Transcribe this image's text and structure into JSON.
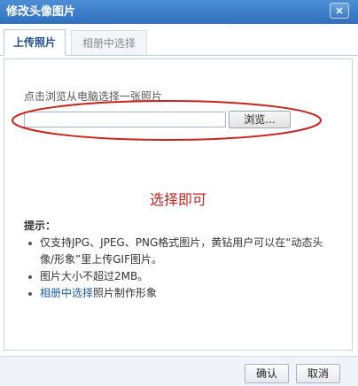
{
  "window": {
    "title": "修改头像图片",
    "close_label": "×"
  },
  "tabs": [
    {
      "label": "上传照片",
      "active": true
    },
    {
      "label": "相册中选择",
      "active": false
    }
  ],
  "upload": {
    "hint": "点击浏览从电脑选择一张照片",
    "file_value": "",
    "browse_label": "浏览..."
  },
  "annotation": {
    "text": "选择即可",
    "color": "#c8241f"
  },
  "tips": {
    "title": "提示：",
    "items": [
      "仅支持JPG、JPEG、PNG格式图片，黄钻用户可以在“动态头像/形象”里上传GIF图片。",
      "图片大小不超过2MB。"
    ],
    "link_item": {
      "link": "相册中选择",
      "rest": "照片制作形象"
    }
  },
  "footer": {
    "ok_label": "确认",
    "cancel_label": "取消"
  },
  "colors": {
    "accent": "#2f6fbf",
    "link": "#1e5aa8",
    "annotation": "#c8241f"
  }
}
